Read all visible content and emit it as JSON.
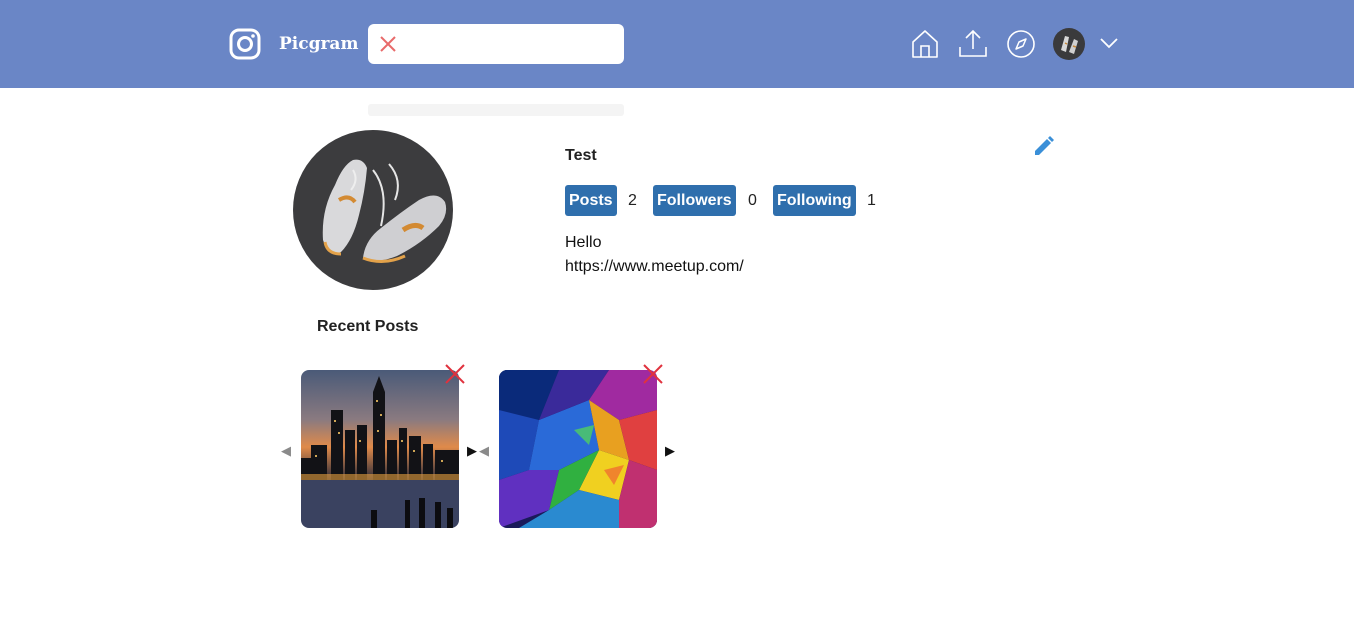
{
  "header": {
    "brand": "Picgram",
    "search": {
      "value": "",
      "placeholder": ""
    },
    "nav": [
      "home-icon",
      "upload-icon",
      "explore-icon",
      "avatar",
      "chevron-down-icon"
    ]
  },
  "profile": {
    "username": "Test",
    "stats": [
      {
        "label": "Posts",
        "count": "2"
      },
      {
        "label": "Followers",
        "count": "0"
      },
      {
        "label": "Following",
        "count": "1"
      }
    ],
    "bio": "Hello",
    "website": "https://www.meetup.com/"
  },
  "recent_posts": {
    "title": "Recent Posts",
    "items": [
      {
        "image": "city-skyline-night-photo"
      },
      {
        "image": "colorful-abstract-photo"
      }
    ]
  },
  "colors": {
    "header_bg": "#6a86c6",
    "stat_button": "#2f6fad",
    "delete": "#e0323e",
    "edit": "#3a8fd8"
  }
}
